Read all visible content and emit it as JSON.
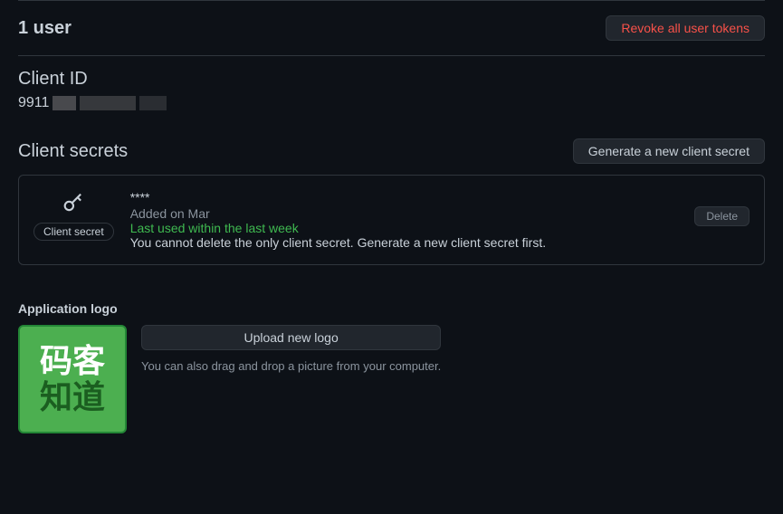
{
  "users": {
    "count_label": "1 user",
    "revoke_button": "Revoke all user tokens"
  },
  "client_id": {
    "title": "Client ID",
    "value_prefix": "9911"
  },
  "client_secrets": {
    "title": "Client secrets",
    "generate_button": "Generate a new client secret",
    "pill_label": "Client secret",
    "masked": "****",
    "added_on": "Added on Mar",
    "last_used": "Last used within the last week",
    "warning": "You cannot delete the only client secret. Generate a new client secret first.",
    "delete_button": "Delete"
  },
  "logo": {
    "label": "Application logo",
    "upload_button": "Upload new logo",
    "drag_hint": "You can also drag and drop a picture from your computer.",
    "preview_text_1": "码客",
    "preview_text_2": "知道"
  }
}
